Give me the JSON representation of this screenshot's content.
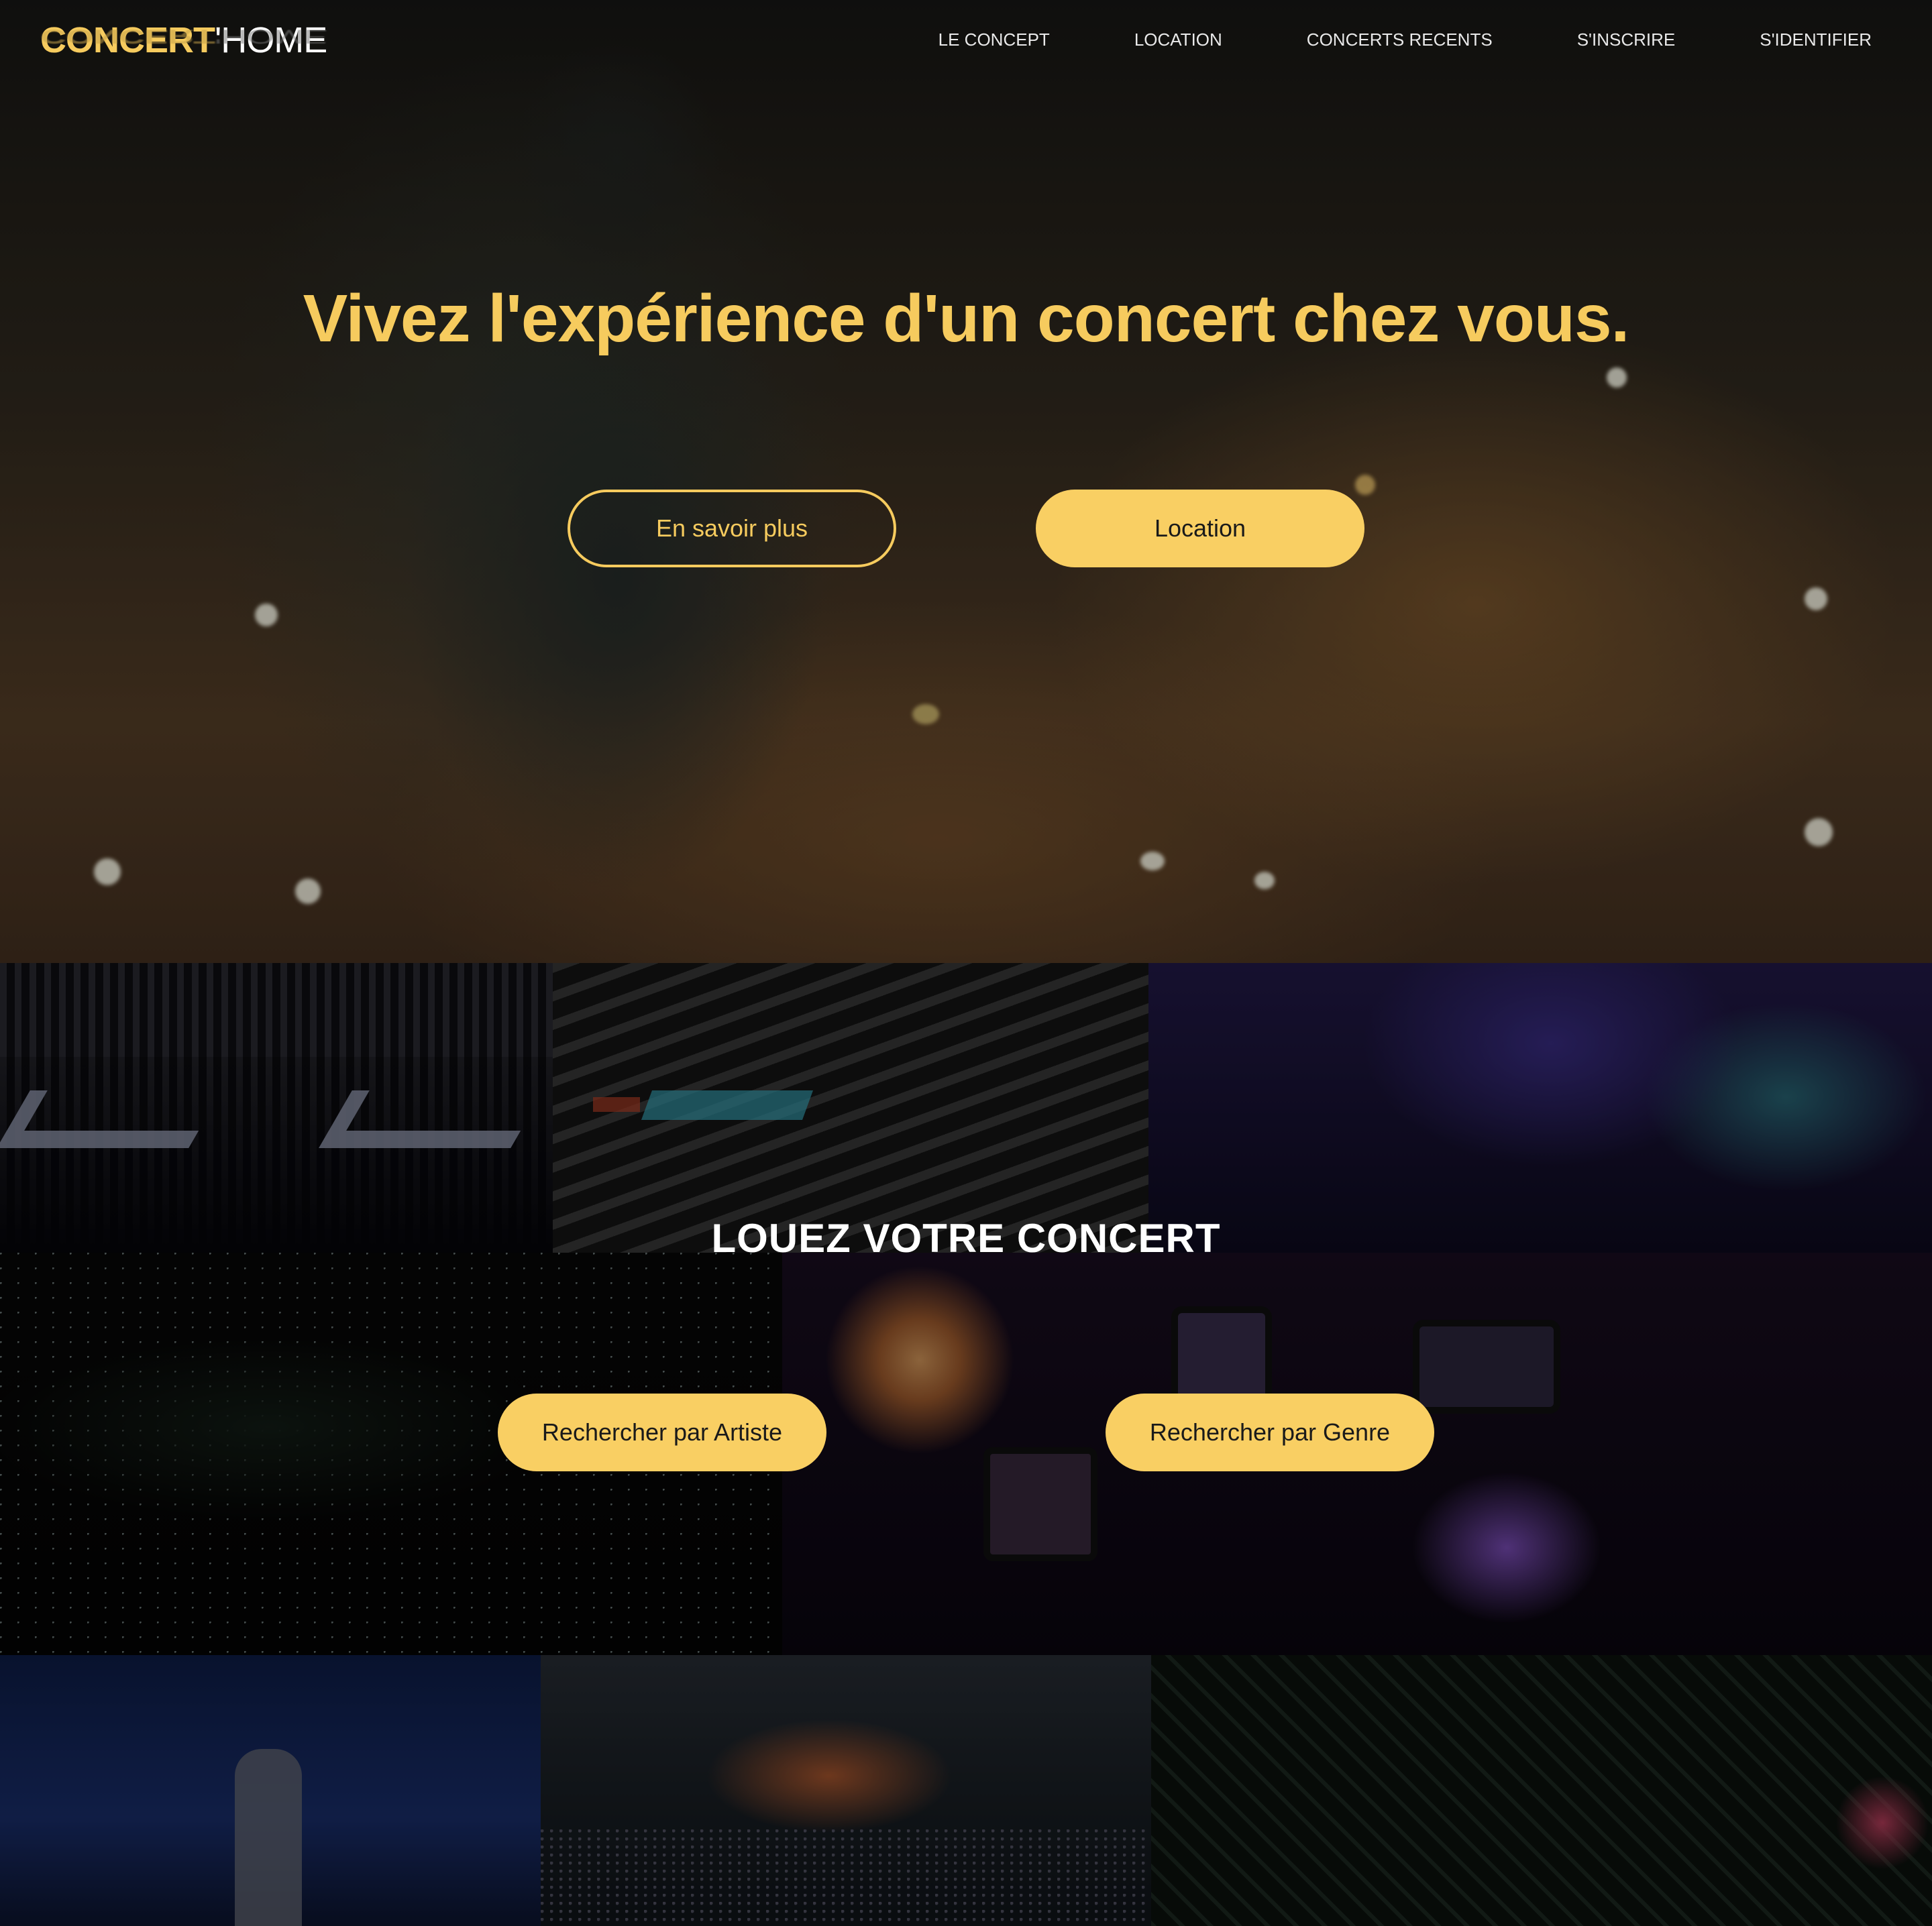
{
  "logo": {
    "concert": "CONCERT",
    "home": "'HOME"
  },
  "nav": {
    "items": [
      "LE CONCEPT",
      "LOCATION",
      "CONCERTS RECENTS",
      "S'INSCRIRE",
      "S'IDENTIFIER"
    ]
  },
  "hero": {
    "headline": "Vivez l'expérience d'un concert chez vous.",
    "learn_more_label": "En savoir plus",
    "location_label": "Location"
  },
  "rent": {
    "title": "LOUEZ VOTRE CONCERT",
    "search_artist_label": "Rechercher par Artiste",
    "search_genre_label": "Rechercher par Genre"
  },
  "colors": {
    "accent": "#f6cb5e",
    "button_fill": "#f9cf63"
  }
}
